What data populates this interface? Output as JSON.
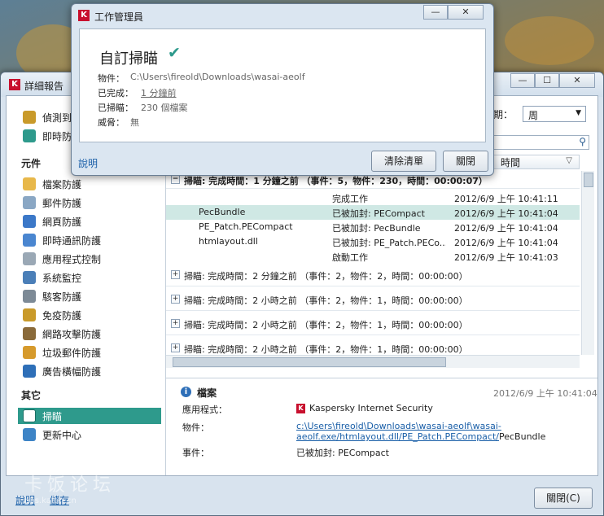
{
  "task_dialog": {
    "title": "工作管理員",
    "heading": "自訂掃瞄",
    "object_label": "物件：",
    "object_value": "C:\\Users\\fireold\\Downloads\\wasai-aeolf",
    "completed_label": "已完成：",
    "completed_value": "1 分鐘前",
    "scanned_label": "已掃瞄：",
    "scanned_value": "230 個檔案",
    "threats_label": "威脅：",
    "threats_value": "無",
    "help_link": "說明",
    "clear_button": "清除清單",
    "close_button": "關閉",
    "min_symbol": "—",
    "close_symbol": "✕",
    "check_symbol": "✔"
  },
  "report_window": {
    "title": "詳細報告",
    "min_symbol": "—",
    "max_symbol": "☐",
    "close_symbol": "✕",
    "detected_label": "偵測到",
    "realtime_label": "即時防",
    "period_label": "期：",
    "period_value": "周",
    "time_column": "時間"
  },
  "sidebar": {
    "components_heading": "元件",
    "components": [
      {
        "label": "檔案防護",
        "icon": "folder-icon",
        "color": "#e8b84a"
      },
      {
        "label": "郵件防護",
        "icon": "mail-icon",
        "color": "#8aa7c4"
      },
      {
        "label": "網頁防護",
        "icon": "globe-icon",
        "color": "#3b78c8"
      },
      {
        "label": "即時通訊防護",
        "icon": "chat-icon",
        "color": "#4a86d0"
      },
      {
        "label": "應用程式控制",
        "icon": "funnel-icon",
        "color": "#9aa8b5"
      },
      {
        "label": "系統監控",
        "icon": "monitor-icon",
        "color": "#4b7fb8"
      },
      {
        "label": "駭客防護",
        "icon": "hourglass-icon",
        "color": "#7d8a96"
      },
      {
        "label": "免疫防護",
        "icon": "shield-icon",
        "color": "#c99a2a"
      },
      {
        "label": "網路攻擊防護",
        "icon": "network-icon",
        "color": "#8a6a3a"
      },
      {
        "label": "垃圾郵件防護",
        "icon": "spam-icon",
        "color": "#d69a2c"
      },
      {
        "label": "廣告橫幅防護",
        "icon": "banner-icon",
        "color": "#2e6fb8"
      }
    ],
    "other_heading": "其它",
    "other": [
      {
        "label": "掃瞄",
        "icon": "scan-icon",
        "color": "#ffffff"
      },
      {
        "label": "更新中心",
        "icon": "update-icon",
        "color": "#3d84c6"
      }
    ]
  },
  "events": {
    "expanded_group": "掃瞄: 完成時間：1 分鐘之前 （事件：5，物件：230，時間：00:00:07）",
    "collapse_symbol": "−",
    "expand_symbol": "+",
    "rows": [
      {
        "object": "",
        "event": "完成工作",
        "time": "2012/6/9 上午 10:41:11",
        "selected": false
      },
      {
        "object": "PecBundle",
        "event": "已被加封: PECompact",
        "time": "2012/6/9 上午 10:41:04",
        "selected": true
      },
      {
        "object": "PE_Patch.PECompact",
        "event": "已被加封: PecBundle",
        "time": "2012/6/9 上午 10:41:04",
        "selected": false
      },
      {
        "object": "htmlayout.dll",
        "event": "已被加封: PE_Patch.PECo...",
        "time": "2012/6/9 上午 10:41:04",
        "selected": false
      },
      {
        "object": "",
        "event": "啟動工作",
        "time": "2012/6/9 上午 10:41:03",
        "selected": false
      }
    ],
    "collapsed_groups": [
      "掃瞄: 完成時間：2 分鐘之前 （事件：2，物件：2，時間：00:00:00）",
      "掃瞄: 完成時間：2 小時之前 （事件：2，物件：1，時間：00:00:00）",
      "掃瞄: 完成時間：2 小時之前 （事件：2，物件：1，時間：00:00:00）",
      "掃瞄: 完成時間：2 小時之前 （事件：2，物件：1，時間：00:00:00）"
    ]
  },
  "details": {
    "title": "檔案",
    "timestamp": "2012/6/9 上午 10:41:04",
    "app_label": "應用程式：",
    "app_value": "Kaspersky Internet Security",
    "object_label": "物件：",
    "object_link_1": "c:\\Users\\fireold\\Downloads\\wasai-aeolf\\wasai-",
    "object_link_2": "aeolf.exe/htmlayout.dll/PE_Patch.PECompact/",
    "object_tail": "PecBundle",
    "event_label": "事件：",
    "event_value": "已被加封: PECompact"
  },
  "bottom": {
    "help": "說明",
    "save": "儲存",
    "close_button": "關閉(C)"
  },
  "watermark": {
    "text": "卡饭论坛",
    "url": "bbs.kafan.cn"
  }
}
